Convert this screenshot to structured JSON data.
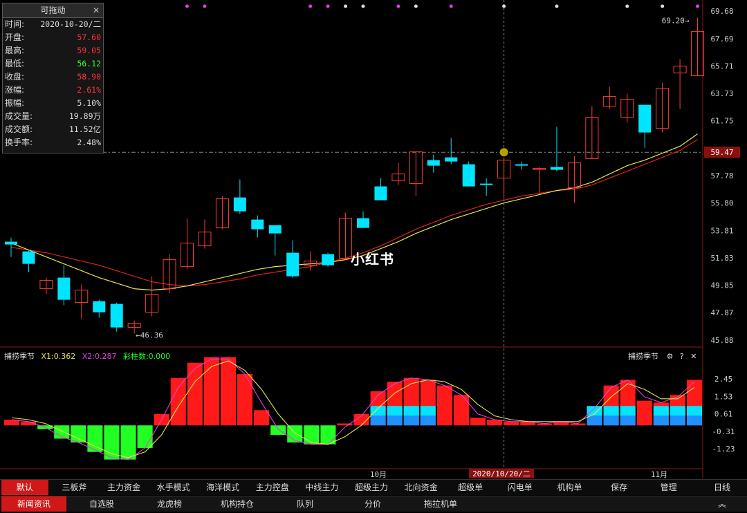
{
  "panel": {
    "title": "可拖动",
    "close": "✕",
    "rows": [
      {
        "k": "时间:",
        "v": "2020-10-20/二",
        "c": "#dddddd"
      },
      {
        "k": "开盘:",
        "v": "57.60",
        "c": "#ff3333"
      },
      {
        "k": "最高:",
        "v": "59.05",
        "c": "#ff3333"
      },
      {
        "k": "最低:",
        "v": "56.12",
        "c": "#33ff33"
      },
      {
        "k": "收盘:",
        "v": "58.90",
        "c": "#ff3333"
      },
      {
        "k": "涨幅:",
        "v": "2.61%",
        "c": "#ff3333"
      },
      {
        "k": "振幅:",
        "v": "5.10%",
        "c": "#dddddd"
      },
      {
        "k": "成交量:",
        "v": "19.89万",
        "c": "#dddddd"
      },
      {
        "k": "成交额:",
        "v": "11.52亿",
        "c": "#dddddd"
      },
      {
        "k": "换手率:",
        "v": "2.48%",
        "c": "#dddddd"
      }
    ]
  },
  "indicator": {
    "name": "捕捞季节",
    "x1": "X1:0.362",
    "x2": "X2:0.287",
    "bars": "彩柱数:0.000",
    "name_right": "捕捞季节"
  },
  "watermark": "小红书",
  "colors": {
    "up": "#ff3c3c",
    "down": "#00e5ff",
    "ma_yellow": "#e6e64a",
    "ma_red": "#e02020",
    "green": "#22ff22",
    "blue": "#1e90ff"
  },
  "chart_data": [
    {
      "type": "candlestick",
      "yaxis_ticks": [
        "69.68",
        "67.69",
        "65.71",
        "63.73",
        "61.75",
        "59.47",
        "57.78",
        "55.80",
        "53.81",
        "51.83",
        "49.85",
        "47.87",
        "45.88"
      ],
      "ylim": [
        45.3,
        70.2
      ],
      "x_labels": [
        "10月",
        "2020/10/20/二",
        "11月"
      ],
      "annotations": {
        "high": "69.20",
        "low": "46.36",
        "crosshair_price": "59.47"
      },
      "candles": [
        {
          "o": 53.0,
          "h": 53.3,
          "c": 52.8,
          "l": 51.9
        },
        {
          "o": 52.3,
          "h": 52.4,
          "c": 51.4,
          "l": 50.8
        },
        {
          "o": 49.6,
          "h": 50.4,
          "c": 50.2,
          "l": 49.2
        },
        {
          "o": 50.4,
          "h": 51.3,
          "c": 48.8,
          "l": 48.4
        },
        {
          "o": 48.6,
          "h": 49.9,
          "c": 49.5,
          "l": 47.4
        },
        {
          "o": 48.7,
          "h": 48.8,
          "c": 47.9,
          "l": 47.5
        },
        {
          "o": 48.5,
          "h": 48.6,
          "c": 46.8,
          "l": 46.5
        },
        {
          "o": 46.8,
          "h": 47.3,
          "c": 47.1,
          "l": 46.36
        },
        {
          "o": 47.9,
          "h": 50.5,
          "c": 49.2,
          "l": 47.6
        },
        {
          "o": 49.6,
          "h": 52.1,
          "c": 51.7,
          "l": 49.3
        },
        {
          "o": 51.2,
          "h": 54.7,
          "c": 52.9,
          "l": 51.0
        },
        {
          "o": 52.7,
          "h": 54.6,
          "c": 53.7,
          "l": 52.5
        },
        {
          "o": 54.0,
          "h": 56.3,
          "c": 56.1,
          "l": 53.9
        },
        {
          "o": 56.2,
          "h": 57.5,
          "c": 55.2,
          "l": 55.0
        },
        {
          "o": 54.6,
          "h": 54.9,
          "c": 53.9,
          "l": 53.3
        },
        {
          "o": 54.2,
          "h": 54.2,
          "c": 53.6,
          "l": 52.0
        },
        {
          "o": 52.2,
          "h": 53.1,
          "c": 50.5,
          "l": 50.4
        },
        {
          "o": 51.3,
          "h": 52.3,
          "c": 51.6,
          "l": 50.9
        },
        {
          "o": 52.1,
          "h": 52.2,
          "c": 51.3,
          "l": 51.2
        },
        {
          "o": 51.8,
          "h": 55.1,
          "c": 54.7,
          "l": 51.7
        },
        {
          "o": 54.7,
          "h": 55.2,
          "c": 54.0,
          "l": 54.0
        },
        {
          "o": 57.0,
          "h": 57.6,
          "c": 56.0,
          "l": 56.0
        },
        {
          "o": 57.4,
          "h": 58.7,
          "c": 57.9,
          "l": 57.1
        },
        {
          "o": 57.2,
          "h": 59.5,
          "c": 59.5,
          "l": 56.3
        },
        {
          "o": 58.9,
          "h": 59.3,
          "c": 58.5,
          "l": 58.0
        },
        {
          "o": 59.1,
          "h": 60.5,
          "c": 58.8,
          "l": 58.6
        },
        {
          "o": 58.6,
          "h": 58.8,
          "c": 57.0,
          "l": 57.0
        },
        {
          "o": 57.2,
          "h": 57.6,
          "c": 57.1,
          "l": 56.3
        },
        {
          "o": 57.6,
          "h": 59.05,
          "c": 58.9,
          "l": 56.12
        },
        {
          "o": 58.6,
          "h": 58.8,
          "c": 58.5,
          "l": 58.2
        },
        {
          "o": 58.3,
          "h": 58.4,
          "c": 58.3,
          "l": 56.5
        },
        {
          "o": 58.4,
          "h": 61.3,
          "c": 58.2,
          "l": 58.1
        },
        {
          "o": 56.9,
          "h": 59.2,
          "c": 58.7,
          "l": 55.8
        },
        {
          "o": 59.0,
          "h": 62.8,
          "c": 62.0,
          "l": 59.0
        },
        {
          "o": 62.8,
          "h": 64.2,
          "c": 63.5,
          "l": 62.6
        },
        {
          "o": 62.0,
          "h": 63.7,
          "c": 63.3,
          "l": 61.6
        },
        {
          "o": 62.9,
          "h": 62.9,
          "c": 60.9,
          "l": 59.8
        },
        {
          "o": 61.2,
          "h": 64.5,
          "c": 64.1,
          "l": 60.9
        },
        {
          "o": 65.2,
          "h": 66.2,
          "c": 65.7,
          "l": 62.6
        },
        {
          "o": 65.0,
          "h": 69.2,
          "c": 68.2,
          "l": 65.0
        }
      ],
      "ma_yellow": [
        52.9,
        52.4,
        51.9,
        51.4,
        50.9,
        50.4,
        50.0,
        49.6,
        49.5,
        49.6,
        49.8,
        50.1,
        50.4,
        50.7,
        51.0,
        51.2,
        51.3,
        51.4,
        51.5,
        51.7,
        52.0,
        52.5,
        53.0,
        53.6,
        54.1,
        54.6,
        55.0,
        55.4,
        55.8,
        56.1,
        56.4,
        56.7,
        56.9,
        57.3,
        57.9,
        58.5,
        58.9,
        59.4,
        59.9,
        60.8
      ],
      "ma_red": [
        52.6,
        52.4,
        52.2,
        51.9,
        51.6,
        51.3,
        50.9,
        50.5,
        50.1,
        49.9,
        49.8,
        49.9,
        50.1,
        50.3,
        50.6,
        50.8,
        51.0,
        51.2,
        51.5,
        51.8,
        52.2,
        52.7,
        53.3,
        53.9,
        54.4,
        54.9,
        55.3,
        55.7,
        56.0,
        56.3,
        56.5,
        56.7,
        56.8,
        57.1,
        57.6,
        58.1,
        58.6,
        59.1,
        59.6,
        60.4
      ]
    },
    {
      "type": "bar",
      "yaxis_ticks": [
        "2.45",
        "1.53",
        "0.61",
        "-0.31",
        "-1.23"
      ],
      "ylim": [
        -2.0,
        3.2
      ],
      "values": [
        0.3,
        0.2,
        -0.2,
        -0.7,
        -0.9,
        -1.4,
        -1.8,
        -1.8,
        -1.2,
        0.6,
        2.5,
        3.3,
        3.6,
        3.6,
        2.7,
        0.8,
        -0.5,
        -0.9,
        -1.0,
        -1.0,
        0.1,
        0.6,
        1.8,
        2.3,
        2.5,
        2.4,
        2.1,
        1.6,
        0.4,
        0.3,
        0.2,
        0.2,
        0.1,
        0.2,
        0.1,
        1.0,
        2.1,
        2.4,
        1.3,
        1.2,
        1.6,
        2.4
      ],
      "colors": [
        "red",
        "red",
        "green",
        "green",
        "green",
        "green",
        "green",
        "green",
        "green",
        "red",
        "red",
        "red",
        "red",
        "red",
        "red",
        "red",
        "green",
        "green",
        "green",
        "green",
        "red",
        "red",
        "mix",
        "mix",
        "mix",
        "mix",
        "red",
        "red",
        "red",
        "red",
        "red",
        "red",
        "red",
        "red",
        "red",
        "mix",
        "mix",
        "mix",
        "red",
        "mix",
        "mix",
        "mix"
      ],
      "line_yellow": [
        0.4,
        0.3,
        0.1,
        -0.3,
        -0.7,
        -1.1,
        -1.5,
        -1.7,
        -1.4,
        -0.5,
        1.0,
        2.3,
        3.1,
        3.4,
        2.9,
        1.9,
        0.6,
        -0.4,
        -0.9,
        -1.0,
        -0.6,
        0.0,
        0.9,
        1.7,
        2.2,
        2.4,
        2.3,
        1.9,
        1.1,
        0.5,
        0.3,
        0.2,
        0.2,
        0.2,
        0.2,
        0.6,
        1.5,
        2.2,
        1.9,
        1.4,
        1.4,
        2.0
      ],
      "line_magenta": [
        0.3,
        0.2,
        -0.1,
        -0.6,
        -0.9,
        -1.3,
        -1.7,
        -1.8,
        -1.2,
        0.3,
        2.0,
        3.0,
        3.5,
        3.5,
        2.7,
        1.2,
        -0.2,
        -0.8,
        -1.0,
        -1.0,
        -0.1,
        0.5,
        1.6,
        2.2,
        2.5,
        2.4,
        2.1,
        1.6,
        0.6,
        0.3,
        0.2,
        0.2,
        0.1,
        0.2,
        0.1,
        0.9,
        2.0,
        2.4,
        1.5,
        1.2,
        1.5,
        2.3
      ]
    }
  ],
  "tabs1": [
    "默认",
    "三板斧",
    "主力资金",
    "水手模式",
    "海洋模式",
    "主力控盘",
    "中线主力",
    "超级主力",
    "北向资金",
    "超级单",
    "闪电单",
    "机构单",
    "保存",
    "管理"
  ],
  "tabs1_right": "日线",
  "tabs2": [
    "新闻资讯",
    "自选股",
    "龙虎榜",
    "机构持仓",
    "队列",
    "分价",
    "拖拉机单"
  ],
  "tabs2_right": "︽"
}
